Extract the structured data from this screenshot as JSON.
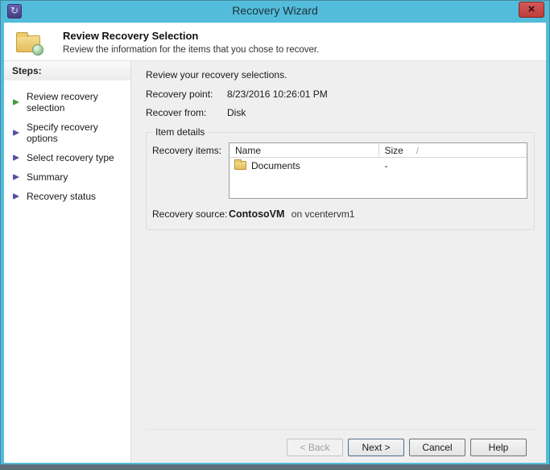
{
  "window": {
    "title": "Recovery Wizard",
    "close_glyph": "×",
    "app_icon_glyph": "↻"
  },
  "header": {
    "title": "Review Recovery Selection",
    "subtitle": "Review the information for the items that you chose to recover."
  },
  "sidebar": {
    "title": "Steps:",
    "items": [
      {
        "label": "Review recovery selection",
        "state": "current"
      },
      {
        "label": "Specify recovery options",
        "state": "upcoming"
      },
      {
        "label": "Select recovery type",
        "state": "upcoming"
      },
      {
        "label": "Summary",
        "state": "upcoming"
      },
      {
        "label": "Recovery status",
        "state": "upcoming"
      }
    ]
  },
  "main": {
    "intro": "Review your recovery selections.",
    "fields": [
      {
        "label": "Recovery point:",
        "value": "8/23/2016 10:26:01 PM"
      },
      {
        "label": "Recover from:",
        "value": "Disk"
      }
    ],
    "group": {
      "title": "Item details",
      "items_label": "Recovery items:",
      "table": {
        "columns": [
          "Name",
          "Size"
        ],
        "sort_indicator": "/",
        "rows": [
          {
            "name": "Documents",
            "size": "-"
          }
        ]
      },
      "source_label": "Recovery source:",
      "source_name": "ContosoVM",
      "source_suffix": "on vcentervm1"
    }
  },
  "buttons": {
    "back": "< Back",
    "next": "Next >",
    "cancel": "Cancel",
    "help": "Help"
  },
  "colors": {
    "frame_blue": "#53bcdb",
    "close_red": "#c9494b",
    "content_gray": "#f0efef",
    "step_current_green": "#3f9e3f",
    "step_purple": "#574fa5",
    "folder_yellow": "#e8c564",
    "bottom_edge": "#5e6e79"
  }
}
